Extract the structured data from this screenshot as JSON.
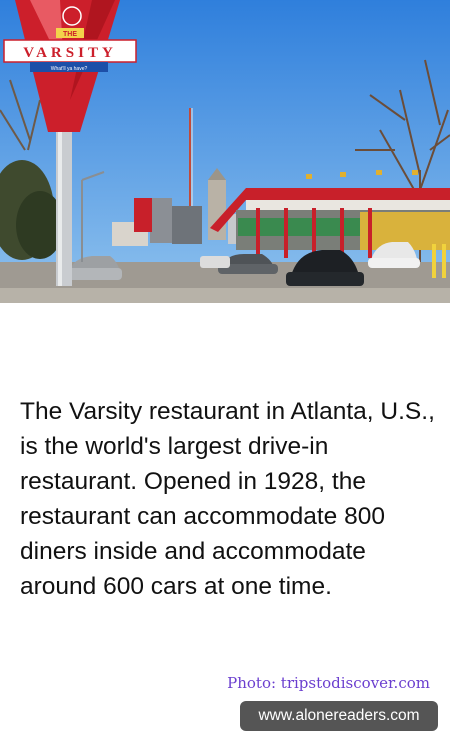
{
  "photo": {
    "sign_top": "THE",
    "sign_main": "VARSITY",
    "sign_sub": "What'll ya have?"
  },
  "caption": {
    "text": "The Varsity restaurant in Atlanta, U.S., is the world's largest drive-in restaurant. Opened in 1928, the restaurant can accommodate 800 diners inside and accommodate around 600 cars at one time."
  },
  "credit": "Photo: tripstodiscover.com",
  "watermark": "www.alonereaders.com"
}
